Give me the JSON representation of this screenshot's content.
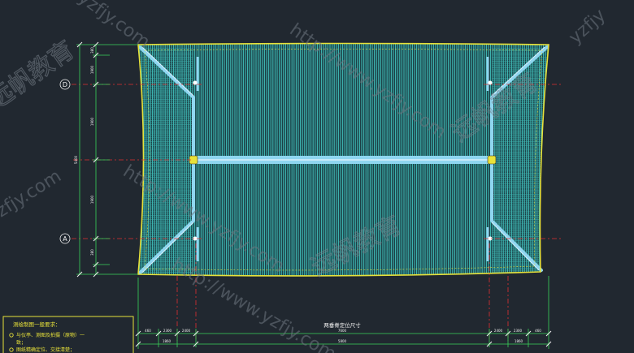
{
  "axis_bubbles": {
    "top": "D",
    "bottom": "A"
  },
  "dimension_title": "两垂脊定位尺寸",
  "notes": {
    "heading": "测绘制图一般要求：",
    "items": [
      "与仪亭、测图及拍摄（原物）一",
      "致；",
      "图纸精确定位、交接清楚；"
    ]
  },
  "dims_left": [
    "380",
    "1900",
    "1900",
    "1900",
    "380",
    "5400"
  ],
  "dims_bottom": {
    "row1": [
      "460",
      "2300",
      "2400",
      "7600",
      "2400",
      "2300",
      "460"
    ],
    "row2": [
      "1860",
      "5800",
      "1860"
    ]
  },
  "watermarks": {
    "url": "http://www.yzfjy.com",
    "url_short": "yzfjy.com",
    "domain_tail": "yzfjy",
    "brand": "远帆教育"
  },
  "colors": {
    "background": "#212830",
    "roof_tile": "#3fb8b4",
    "ridge": "#8fd6f0",
    "outline": "#e8e23a",
    "axis": "#e03030",
    "dim_line": "#3ad25a",
    "text": "#f2f2f2"
  }
}
